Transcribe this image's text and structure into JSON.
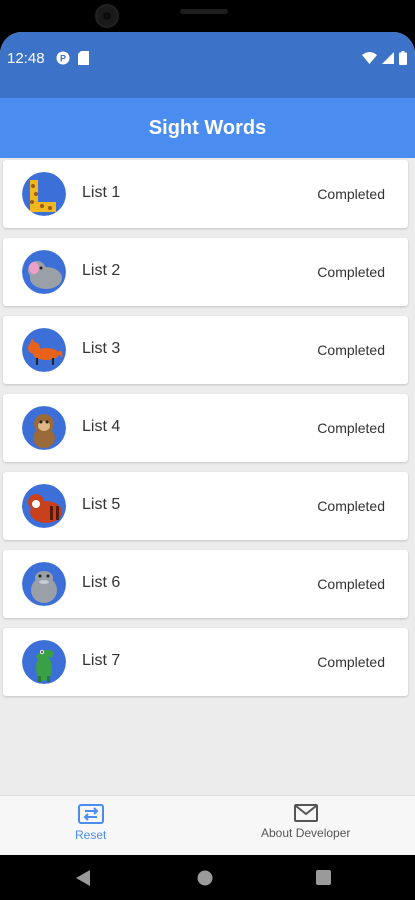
{
  "status_bar": {
    "time": "12:48",
    "icons_left": [
      "p-icon",
      "sd-card-icon"
    ],
    "icons_right": [
      "wifi-icon",
      "signal-icon",
      "battery-icon"
    ]
  },
  "app_bar": {
    "title": "Sight Words"
  },
  "lists": [
    {
      "label": "List 1",
      "status": "Completed",
      "animal": "giraffe",
      "bg": "#3d6fd8"
    },
    {
      "label": "List 2",
      "status": "Completed",
      "animal": "elephant",
      "bg": "#3d6fd8"
    },
    {
      "label": "List 3",
      "status": "Completed",
      "animal": "fox",
      "bg": "#3d6fd8"
    },
    {
      "label": "List 4",
      "status": "Completed",
      "animal": "monkey",
      "bg": "#3d6fd8"
    },
    {
      "label": "List 5",
      "status": "Completed",
      "animal": "red-panda",
      "bg": "#3d6fd8"
    },
    {
      "label": "List 6",
      "status": "Completed",
      "animal": "hippo",
      "bg": "#3d6fd8"
    },
    {
      "label": "List 7",
      "status": "Completed",
      "animal": "crocodile",
      "bg": "#3d6fd8"
    }
  ],
  "bottom_nav": {
    "reset_label": "Reset",
    "about_label": "About Developer",
    "active_color": "#4a8cf0",
    "inactive_color": "#555555"
  },
  "colors": {
    "status_bar": "#3d72c9",
    "app_bar": "#4a8cf0",
    "background": "#ececec"
  }
}
